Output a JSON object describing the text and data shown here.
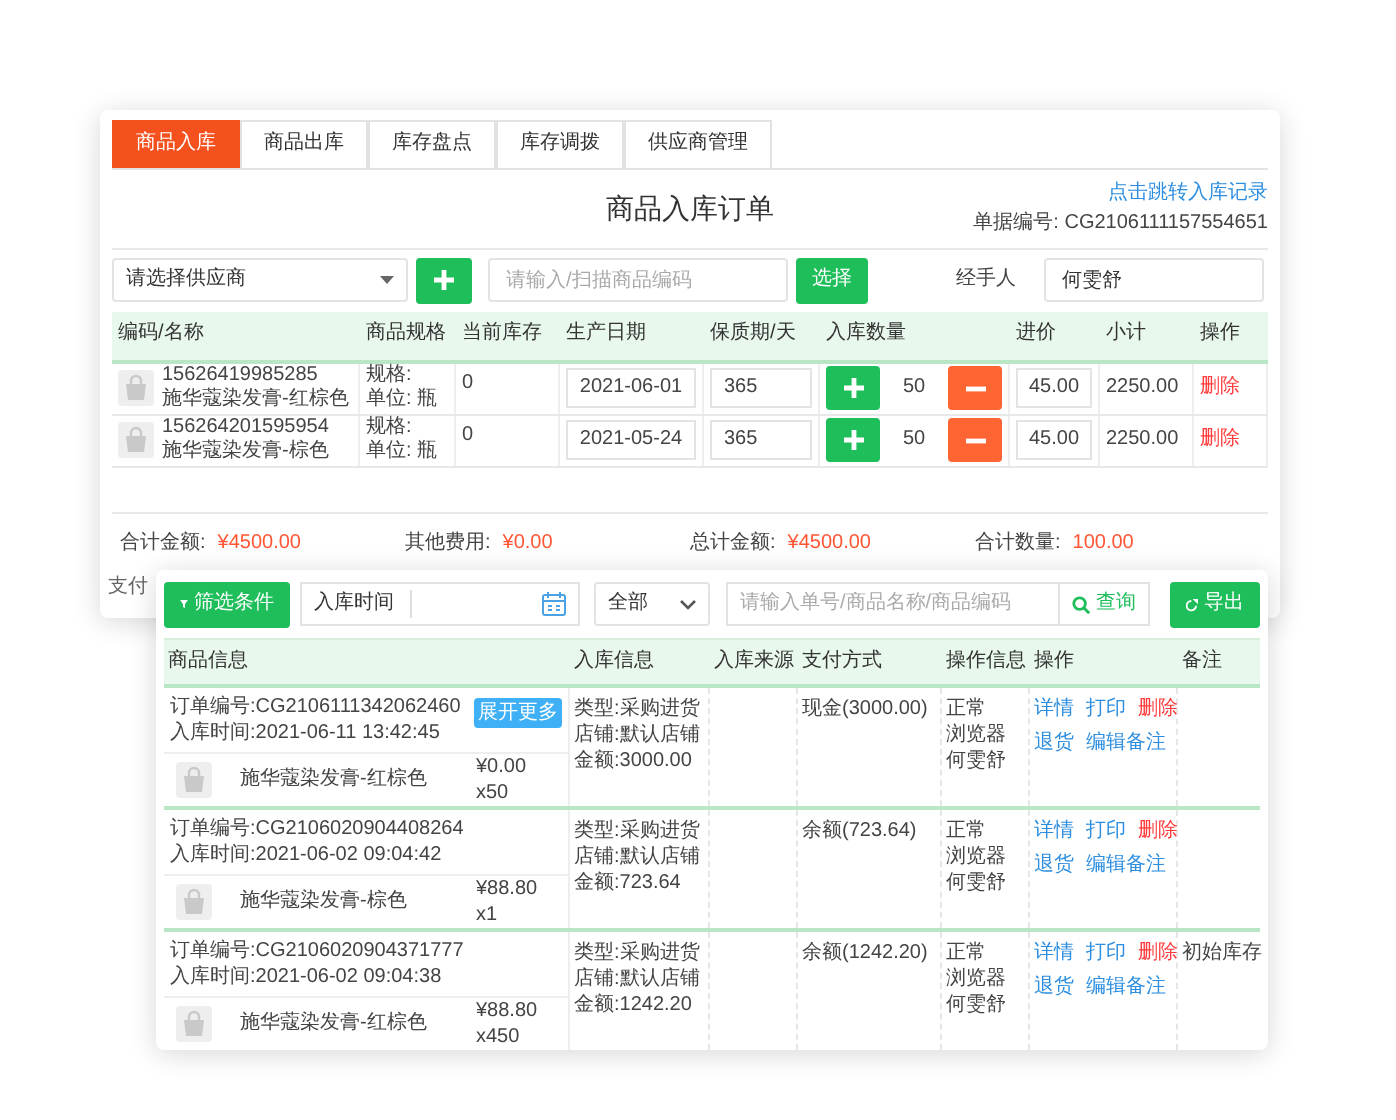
{
  "order_card": {
    "tabs": [
      {
        "label": "商品入库",
        "selected": true
      },
      {
        "label": "商品出库",
        "selected": false
      },
      {
        "label": "库存盘点",
        "selected": false
      },
      {
        "label": "库存调拨",
        "selected": false
      },
      {
        "label": "供应商管理",
        "selected": false
      }
    ],
    "title": "商品入库订单",
    "records_link": "点击跳转入库记录",
    "doc_number": "单据编号: CG2106111157554651",
    "supplier_select": {
      "placeholder": "请选择供应商"
    },
    "product_search": {
      "placeholder": "请输入/扫描商品编码"
    },
    "choose_button": "选择",
    "handler": {
      "label": "经手人",
      "value": "何雯舒"
    },
    "table": {
      "columns": [
        "编码/名称",
        "商品规格",
        "当前库存",
        "生产日期",
        "保质期/天",
        "入库数量",
        "进价",
        "小计",
        "操作"
      ],
      "rows": [
        {
          "code": "15626419985285",
          "name": "施华蔻染发膏-红棕色",
          "spec": "规格:",
          "unit": "单位: 瓶",
          "stock": "0",
          "date": "2021-06-01",
          "shelf_life": "365",
          "quantity": "50",
          "price": "45.00",
          "subtotal": "2250.00",
          "action": "删除"
        },
        {
          "code": "156264201595954",
          "name": "施华蔻染发膏-棕色",
          "spec": "规格:",
          "unit": "单位: 瓶",
          "stock": "0",
          "date": "2021-05-24",
          "shelf_life": "365",
          "quantity": "50",
          "price": "45.00",
          "subtotal": "2250.00",
          "action": "删除"
        }
      ]
    },
    "totals": [
      {
        "label": "合计金额:",
        "value": "¥4500.00"
      },
      {
        "label": "其他费用:",
        "value": "¥0.00"
      },
      {
        "label": "总计金额:",
        "value": "¥4500.00"
      },
      {
        "label": "合计数量:",
        "value": "100.00"
      }
    ],
    "payment_label": "支付"
  },
  "record_card": {
    "filter_button": "筛选条件",
    "date_filter": {
      "label": "入库时间"
    },
    "status_select": {
      "value": "全部"
    },
    "search": {
      "placeholder": "请输入单号/商品名称/商品编码"
    },
    "search_button": "查询",
    "export_button": "导出",
    "table": {
      "columns": [
        "商品信息",
        "入库信息",
        "入库来源",
        "支付方式",
        "操作信息",
        "操作",
        "备注"
      ],
      "orders": [
        {
          "order_no": "订单编号:CG2106111342062460",
          "time": "入库时间:2021-06-11 13:42:45",
          "expand_badge": "展开更多",
          "product": {
            "name": "施华蔻染发膏-红棕色",
            "price": "¥0.00",
            "qty": "x50"
          },
          "info": [
            "类型:采购进货",
            "店铺:默认店铺",
            "金额:3000.00"
          ],
          "payment": "现金(3000.00)",
          "op_info": [
            "正常",
            "浏览器",
            "何雯舒"
          ],
          "action_lines": [
            [
              {
                "label": "详情",
                "kind": "normal"
              },
              {
                "label": "打印",
                "kind": "normal"
              },
              {
                "label": "删除",
                "kind": "danger"
              }
            ],
            [
              {
                "label": "退货",
                "kind": "normal"
              },
              {
                "label": "编辑备注",
                "kind": "normal"
              }
            ]
          ]
        },
        {
          "order_no": "订单编号:CG2106020904408264",
          "time": "入库时间:2021-06-02 09:04:42",
          "product": {
            "name": "施华蔻染发膏-棕色",
            "price": "¥88.80",
            "qty": "x1"
          },
          "info": [
            "类型:采购进货",
            "店铺:默认店铺",
            "金额:723.64"
          ],
          "payment": "余额(723.64)",
          "op_info": [
            "正常",
            "浏览器",
            "何雯舒"
          ],
          "action_lines": [
            [
              {
                "label": "详情",
                "kind": "normal"
              },
              {
                "label": "打印",
                "kind": "normal"
              },
              {
                "label": "删除",
                "kind": "danger"
              }
            ],
            [
              {
                "label": "退货",
                "kind": "normal"
              },
              {
                "label": "编辑备注",
                "kind": "normal"
              }
            ]
          ]
        },
        {
          "order_no": "订单编号:CG2106020904371777",
          "time": "入库时间:2021-06-02 09:04:38",
          "product": {
            "name": "施华蔻染发膏-红棕色",
            "price": "¥88.80",
            "qty": "x450"
          },
          "info": [
            "类型:采购进货",
            "店铺:默认店铺",
            "金额:1242.20"
          ],
          "payment": "余额(1242.20)",
          "op_info": [
            "正常",
            "浏览器",
            "何雯舒"
          ],
          "action_lines": [
            [
              {
                "label": "详情",
                "kind": "normal"
              },
              {
                "label": "打印",
                "kind": "normal"
              },
              {
                "label": "删除",
                "kind": "danger"
              }
            ],
            [
              {
                "label": "退货",
                "kind": "normal"
              },
              {
                "label": "编辑备注",
                "kind": "normal"
              }
            ]
          ],
          "remark": "初始库存"
        }
      ]
    }
  }
}
